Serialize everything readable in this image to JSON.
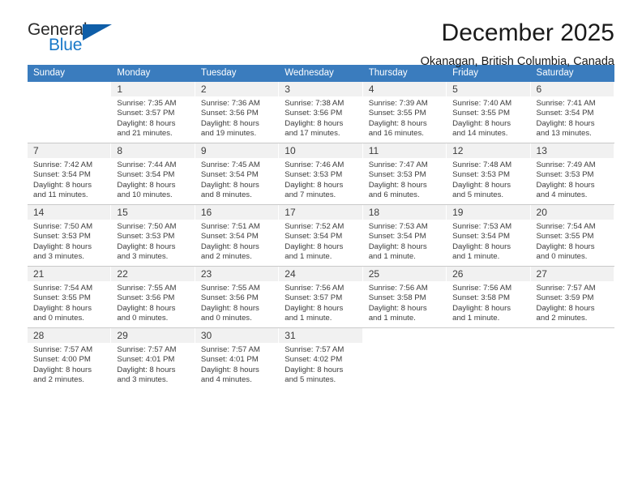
{
  "logo": {
    "word_one": "General",
    "word_two": "Blue",
    "triangle_color": "#0f5ea8",
    "blue_text_color": "#1878c8",
    "icon": "triangle-icon"
  },
  "header": {
    "title": "December 2025",
    "subtitle": "Okanagan, British Columbia, Canada"
  },
  "theme": {
    "header_bar_color": "#3a7cbe",
    "day_number_band": "#f1f1f1",
    "grid_line": "#c9c9c9",
    "text_color": "#3c3c3c"
  },
  "weekday_headers": [
    "Sunday",
    "Monday",
    "Tuesday",
    "Wednesday",
    "Thursday",
    "Friday",
    "Saturday"
  ],
  "labels": {
    "sunrise_prefix": "Sunrise:",
    "sunset_prefix": "Sunset:",
    "daylight_prefix": "Daylight:"
  },
  "weeks": [
    [
      {
        "day": "",
        "sunrise": "",
        "sunset": "",
        "daylight_line1": "",
        "daylight_line2": ""
      },
      {
        "day": "1",
        "sunrise": "Sunrise: 7:35 AM",
        "sunset": "Sunset: 3:57 PM",
        "daylight_line1": "Daylight: 8 hours",
        "daylight_line2": "and 21 minutes."
      },
      {
        "day": "2",
        "sunrise": "Sunrise: 7:36 AM",
        "sunset": "Sunset: 3:56 PM",
        "daylight_line1": "Daylight: 8 hours",
        "daylight_line2": "and 19 minutes."
      },
      {
        "day": "3",
        "sunrise": "Sunrise: 7:38 AM",
        "sunset": "Sunset: 3:56 PM",
        "daylight_line1": "Daylight: 8 hours",
        "daylight_line2": "and 17 minutes."
      },
      {
        "day": "4",
        "sunrise": "Sunrise: 7:39 AM",
        "sunset": "Sunset: 3:55 PM",
        "daylight_line1": "Daylight: 8 hours",
        "daylight_line2": "and 16 minutes."
      },
      {
        "day": "5",
        "sunrise": "Sunrise: 7:40 AM",
        "sunset": "Sunset: 3:55 PM",
        "daylight_line1": "Daylight: 8 hours",
        "daylight_line2": "and 14 minutes."
      },
      {
        "day": "6",
        "sunrise": "Sunrise: 7:41 AM",
        "sunset": "Sunset: 3:54 PM",
        "daylight_line1": "Daylight: 8 hours",
        "daylight_line2": "and 13 minutes."
      }
    ],
    [
      {
        "day": "7",
        "sunrise": "Sunrise: 7:42 AM",
        "sunset": "Sunset: 3:54 PM",
        "daylight_line1": "Daylight: 8 hours",
        "daylight_line2": "and 11 minutes."
      },
      {
        "day": "8",
        "sunrise": "Sunrise: 7:44 AM",
        "sunset": "Sunset: 3:54 PM",
        "daylight_line1": "Daylight: 8 hours",
        "daylight_line2": "and 10 minutes."
      },
      {
        "day": "9",
        "sunrise": "Sunrise: 7:45 AM",
        "sunset": "Sunset: 3:54 PM",
        "daylight_line1": "Daylight: 8 hours",
        "daylight_line2": "and 8 minutes."
      },
      {
        "day": "10",
        "sunrise": "Sunrise: 7:46 AM",
        "sunset": "Sunset: 3:53 PM",
        "daylight_line1": "Daylight: 8 hours",
        "daylight_line2": "and 7 minutes."
      },
      {
        "day": "11",
        "sunrise": "Sunrise: 7:47 AM",
        "sunset": "Sunset: 3:53 PM",
        "daylight_line1": "Daylight: 8 hours",
        "daylight_line2": "and 6 minutes."
      },
      {
        "day": "12",
        "sunrise": "Sunrise: 7:48 AM",
        "sunset": "Sunset: 3:53 PM",
        "daylight_line1": "Daylight: 8 hours",
        "daylight_line2": "and 5 minutes."
      },
      {
        "day": "13",
        "sunrise": "Sunrise: 7:49 AM",
        "sunset": "Sunset: 3:53 PM",
        "daylight_line1": "Daylight: 8 hours",
        "daylight_line2": "and 4 minutes."
      }
    ],
    [
      {
        "day": "14",
        "sunrise": "Sunrise: 7:50 AM",
        "sunset": "Sunset: 3:53 PM",
        "daylight_line1": "Daylight: 8 hours",
        "daylight_line2": "and 3 minutes."
      },
      {
        "day": "15",
        "sunrise": "Sunrise: 7:50 AM",
        "sunset": "Sunset: 3:53 PM",
        "daylight_line1": "Daylight: 8 hours",
        "daylight_line2": "and 3 minutes."
      },
      {
        "day": "16",
        "sunrise": "Sunrise: 7:51 AM",
        "sunset": "Sunset: 3:54 PM",
        "daylight_line1": "Daylight: 8 hours",
        "daylight_line2": "and 2 minutes."
      },
      {
        "day": "17",
        "sunrise": "Sunrise: 7:52 AM",
        "sunset": "Sunset: 3:54 PM",
        "daylight_line1": "Daylight: 8 hours",
        "daylight_line2": "and 1 minute."
      },
      {
        "day": "18",
        "sunrise": "Sunrise: 7:53 AM",
        "sunset": "Sunset: 3:54 PM",
        "daylight_line1": "Daylight: 8 hours",
        "daylight_line2": "and 1 minute."
      },
      {
        "day": "19",
        "sunrise": "Sunrise: 7:53 AM",
        "sunset": "Sunset: 3:54 PM",
        "daylight_line1": "Daylight: 8 hours",
        "daylight_line2": "and 1 minute."
      },
      {
        "day": "20",
        "sunrise": "Sunrise: 7:54 AM",
        "sunset": "Sunset: 3:55 PM",
        "daylight_line1": "Daylight: 8 hours",
        "daylight_line2": "and 0 minutes."
      }
    ],
    [
      {
        "day": "21",
        "sunrise": "Sunrise: 7:54 AM",
        "sunset": "Sunset: 3:55 PM",
        "daylight_line1": "Daylight: 8 hours",
        "daylight_line2": "and 0 minutes."
      },
      {
        "day": "22",
        "sunrise": "Sunrise: 7:55 AM",
        "sunset": "Sunset: 3:56 PM",
        "daylight_line1": "Daylight: 8 hours",
        "daylight_line2": "and 0 minutes."
      },
      {
        "day": "23",
        "sunrise": "Sunrise: 7:55 AM",
        "sunset": "Sunset: 3:56 PM",
        "daylight_line1": "Daylight: 8 hours",
        "daylight_line2": "and 0 minutes."
      },
      {
        "day": "24",
        "sunrise": "Sunrise: 7:56 AM",
        "sunset": "Sunset: 3:57 PM",
        "daylight_line1": "Daylight: 8 hours",
        "daylight_line2": "and 1 minute."
      },
      {
        "day": "25",
        "sunrise": "Sunrise: 7:56 AM",
        "sunset": "Sunset: 3:58 PM",
        "daylight_line1": "Daylight: 8 hours",
        "daylight_line2": "and 1 minute."
      },
      {
        "day": "26",
        "sunrise": "Sunrise: 7:56 AM",
        "sunset": "Sunset: 3:58 PM",
        "daylight_line1": "Daylight: 8 hours",
        "daylight_line2": "and 1 minute."
      },
      {
        "day": "27",
        "sunrise": "Sunrise: 7:57 AM",
        "sunset": "Sunset: 3:59 PM",
        "daylight_line1": "Daylight: 8 hours",
        "daylight_line2": "and 2 minutes."
      }
    ],
    [
      {
        "day": "28",
        "sunrise": "Sunrise: 7:57 AM",
        "sunset": "Sunset: 4:00 PM",
        "daylight_line1": "Daylight: 8 hours",
        "daylight_line2": "and 2 minutes."
      },
      {
        "day": "29",
        "sunrise": "Sunrise: 7:57 AM",
        "sunset": "Sunset: 4:01 PM",
        "daylight_line1": "Daylight: 8 hours",
        "daylight_line2": "and 3 minutes."
      },
      {
        "day": "30",
        "sunrise": "Sunrise: 7:57 AM",
        "sunset": "Sunset: 4:01 PM",
        "daylight_line1": "Daylight: 8 hours",
        "daylight_line2": "and 4 minutes."
      },
      {
        "day": "31",
        "sunrise": "Sunrise: 7:57 AM",
        "sunset": "Sunset: 4:02 PM",
        "daylight_line1": "Daylight: 8 hours",
        "daylight_line2": "and 5 minutes."
      },
      {
        "day": "",
        "sunrise": "",
        "sunset": "",
        "daylight_line1": "",
        "daylight_line2": ""
      },
      {
        "day": "",
        "sunrise": "",
        "sunset": "",
        "daylight_line1": "",
        "daylight_line2": ""
      },
      {
        "day": "",
        "sunrise": "",
        "sunset": "",
        "daylight_line1": "",
        "daylight_line2": ""
      }
    ]
  ]
}
